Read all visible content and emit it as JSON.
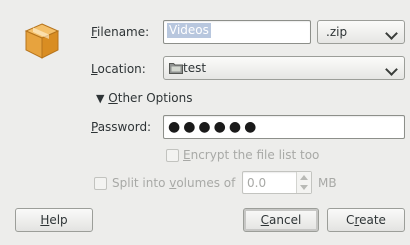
{
  "filename": {
    "label_first": "F",
    "label_rest": "ilename:",
    "value": "Videos",
    "extension": ".zip"
  },
  "location": {
    "label_first": "L",
    "label_rest": "ocation:",
    "folder_name": "test"
  },
  "other_options": {
    "arrow": "▼",
    "label_first": "O",
    "label_rest": "ther Options"
  },
  "password": {
    "label_first": "P",
    "label_rest": "assword:",
    "masked_value": "●●●●●●"
  },
  "encrypt": {
    "label_first": "E",
    "label_rest": "ncrypt the file list too"
  },
  "split": {
    "label_before": "Split into ",
    "label_first": "v",
    "label_rest": "olumes of",
    "value": "0.0",
    "unit": "MB"
  },
  "buttons": {
    "help_first": "H",
    "help_rest": "elp",
    "cancel_first": "C",
    "cancel_rest": "ancel",
    "create_first": "",
    "create_rest": "Create",
    "create_mn_before": "C",
    "create_mn": "r",
    "create_mn_after": "eate"
  },
  "icons": {
    "archive": "archive-box-icon",
    "folder": "folder-icon",
    "spin_up": "spin-up-icon",
    "spin_down": "spin-down-icon",
    "chevron": "chevron-down-icon"
  },
  "colors": {
    "background": "#ededeb",
    "selection": "#b8c7de",
    "archive_orange": "#e7a33e"
  }
}
